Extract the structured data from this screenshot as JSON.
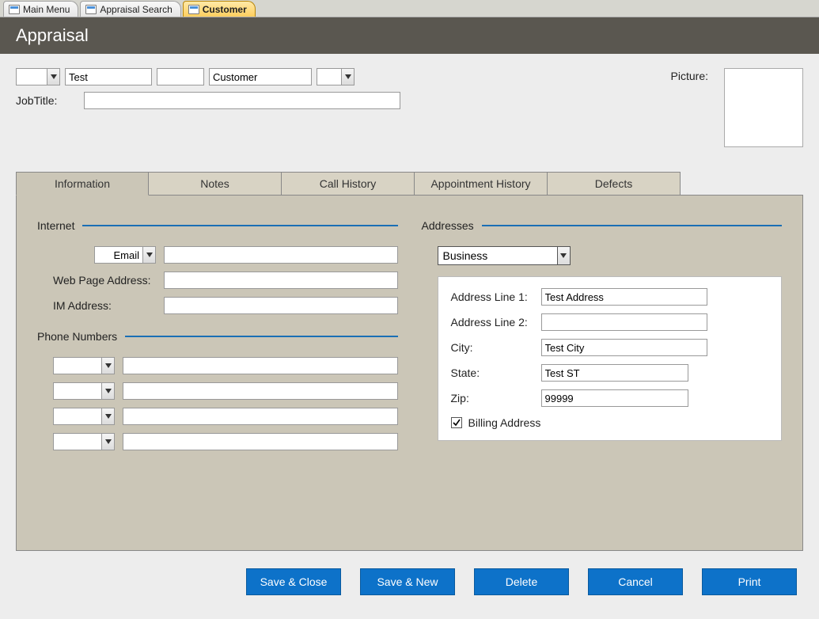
{
  "app_tabs": [
    {
      "label": "Main Menu",
      "active": false
    },
    {
      "label": "Appraisal Search",
      "active": false
    },
    {
      "label": "Customer",
      "active": true
    }
  ],
  "title": "Appraisal",
  "header": {
    "prefix": "",
    "first_name": "Test",
    "middle": "",
    "last_name": "Customer",
    "suffix": "",
    "jobtitle_label": "JobTitle:",
    "jobtitle": "",
    "picture_label": "Picture:"
  },
  "form_tabs": [
    "Information",
    "Notes",
    "Call History",
    "Appointment History",
    "Defects"
  ],
  "active_form_tab": 0,
  "internet": {
    "legend": "Internet",
    "email_type": "Email",
    "email_value": "",
    "webpage_label": "Web Page Address:",
    "webpage_value": "",
    "im_label": "IM Address:",
    "im_value": ""
  },
  "phones": {
    "legend": "Phone Numbers",
    "rows": [
      {
        "type": "",
        "number": ""
      },
      {
        "type": "",
        "number": ""
      },
      {
        "type": "",
        "number": ""
      },
      {
        "type": "",
        "number": ""
      }
    ]
  },
  "addresses": {
    "legend": "Addresses",
    "type": "Business",
    "line1_label": "Address Line 1:",
    "line1": "Test Address",
    "line2_label": "Address Line 2:",
    "line2": "",
    "city_label": "City:",
    "city": "Test City",
    "state_label": "State:",
    "state": "Test ST",
    "zip_label": "Zip:",
    "zip": "99999",
    "billing_checked": true,
    "billing_label": "Billing Address"
  },
  "buttons": {
    "save_close": "Save & Close",
    "save_new": "Save & New",
    "delete": "Delete",
    "cancel": "Cancel",
    "print": "Print"
  }
}
